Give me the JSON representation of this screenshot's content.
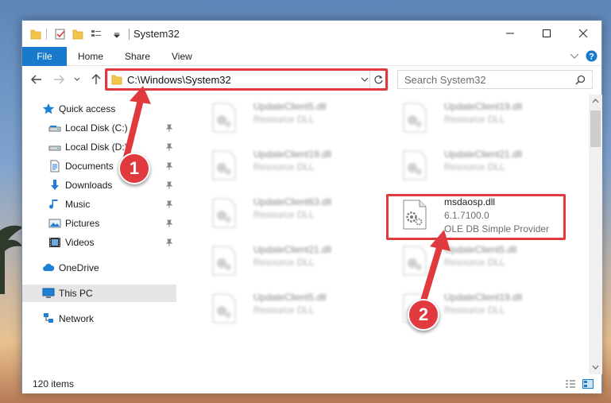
{
  "window": {
    "title": "System32",
    "controls": {
      "minimize_icon": "minimize-icon",
      "maximize_icon": "maximize-icon",
      "close_icon": "close-icon"
    }
  },
  "ribbon": {
    "tabs": [
      {
        "label": "File",
        "active": true
      },
      {
        "label": "Home"
      },
      {
        "label": "Share"
      },
      {
        "label": "View"
      }
    ]
  },
  "address": {
    "path": "C:\\Windows\\System32"
  },
  "search": {
    "placeholder": "Search System32"
  },
  "sidebar": {
    "items": [
      {
        "label": "Quick access",
        "icon": "star-icon"
      },
      {
        "label": "Local Disk (C:)",
        "icon": "drive-icon",
        "pinned": true
      },
      {
        "label": "Local Disk (D:)",
        "icon": "drive-icon",
        "pinned": true
      },
      {
        "label": "Documents",
        "icon": "documents-icon",
        "pinned": true
      },
      {
        "label": "Downloads",
        "icon": "download-icon",
        "pinned": true
      },
      {
        "label": "Music",
        "icon": "music-icon",
        "pinned": true
      },
      {
        "label": "Pictures",
        "icon": "pictures-icon",
        "pinned": true
      },
      {
        "label": "Videos",
        "icon": "videos-icon",
        "pinned": true
      },
      {
        "label": "OneDrive",
        "icon": "cloud-icon"
      },
      {
        "label": "This PC",
        "icon": "computer-icon",
        "selected": true
      },
      {
        "label": "Network",
        "icon": "network-icon"
      }
    ]
  },
  "files": [
    {
      "name": "UpdateClient5.dll",
      "desc": "Resource DLL"
    },
    {
      "name": "UpdateClient19.dll",
      "desc": "Resource DLL"
    },
    {
      "name": "UpdateClient19.dll",
      "desc": "Resource DLL"
    },
    {
      "name": "UpdateClient21.dll",
      "desc": "Resource DLL"
    },
    {
      "name": "UpdateClient63.dll",
      "desc": "Resource DLL"
    },
    {
      "name": "msdaosp.dll",
      "version": "6.1.7100.0",
      "desc": "OLE DB Simple Provider",
      "highlighted": true
    },
    {
      "name": "UpdateClient21.dll",
      "desc": "Resource DLL"
    },
    {
      "name": "UpdateClient5.dll",
      "desc": "Resource DLL"
    },
    {
      "name": "UpdateClient5.dll",
      "desc": "Resource DLL"
    },
    {
      "name": "UpdateClient19.dll",
      "desc": "Resource DLL"
    }
  ],
  "status": {
    "item_count": "120 items"
  },
  "annotations": {
    "step1": "1",
    "step2": "2",
    "color": "#e0393e"
  },
  "colors": {
    "accent": "#1979ca",
    "highlight": "#e0393e",
    "selected_bg": "#e5e5e5"
  }
}
